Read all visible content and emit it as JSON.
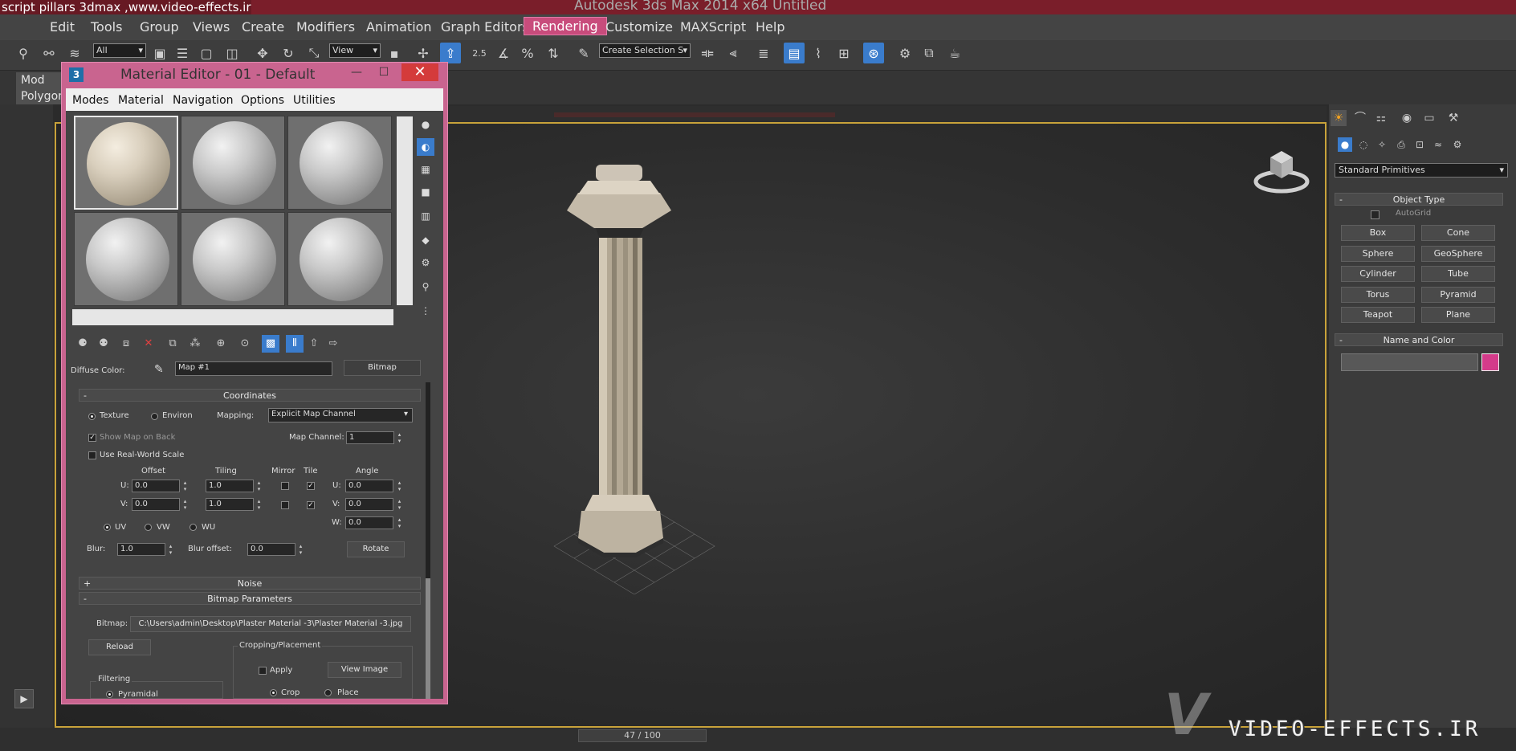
{
  "video_title": "script pillars 3dmax ,www.video-effects.ir",
  "app_title": "Autodesk 3ds Max  2014 x64     Untitled",
  "menu": [
    "Edit",
    "Tools",
    "Group",
    "Views",
    "Create",
    "Modifiers",
    "Animation",
    "Graph Editors",
    "Rendering",
    "Customize",
    "MAXScript",
    "Help"
  ],
  "toolbar": {
    "filter_select": "All",
    "ref_coord_select": "View",
    "named_selection_placeholder": "Create Selection S",
    "percent_snap": "%",
    "angle_snap": "2.5"
  },
  "ribbon": {
    "tab_modeling": "Mod",
    "tab_polygon": "Polygon"
  },
  "material_editor": {
    "title": "Material Editor - 01 - Default",
    "menu": [
      "Modes",
      "Material",
      "Navigation",
      "Options",
      "Utilities"
    ],
    "diffuse_label": "Diffuse Color:",
    "map_name": "Map #1",
    "map_type": "Bitmap",
    "coordinates": {
      "title": "Coordinates",
      "texture_label": "Texture",
      "environ_label": "Environ",
      "mapping_label": "Mapping:",
      "mapping_value": "Explicit Map Channel",
      "show_map_on_back": "Show Map on Back",
      "use_real_world": "Use Real-World Scale",
      "map_channel_label": "Map Channel:",
      "map_channel_value": "1",
      "offset_label": "Offset",
      "tiling_label": "Tiling",
      "mirror_label": "Mirror",
      "tile_label": "Tile",
      "angle_label": "Angle",
      "u_label": "U:",
      "v_label": "V:",
      "w_label": "W:",
      "u_offset": "0.0",
      "v_offset": "0.0",
      "u_tiling": "1.0",
      "v_tiling": "1.0",
      "u_angle": "0.0",
      "v_angle": "0.0",
      "w_angle": "0.0",
      "uv_label": "UV",
      "vw_label": "VW",
      "wu_label": "WU",
      "blur_label": "Blur:",
      "blur_value": "1.0",
      "blur_offset_label": "Blur offset:",
      "blur_offset_value": "0.0",
      "rotate_button": "Rotate"
    },
    "noise": {
      "title": "Noise",
      "toggle": "+"
    },
    "bitmap_params": {
      "title": "Bitmap Parameters",
      "bitmap_label": "Bitmap:",
      "bitmap_path": "C:\\Users\\admin\\Desktop\\Plaster Material -3\\Plaster Material -3.jpg",
      "reload_button": "Reload",
      "cropping_label": "Cropping/Placement",
      "apply_label": "Apply",
      "view_image_button": "View Image",
      "filtering_label": "Filtering",
      "pyramidal_label": "Pyramidal",
      "crop_label": "Crop",
      "place_label": "Place"
    }
  },
  "command_panel": {
    "category": "Standard Primitives",
    "object_type_title": "Object Type",
    "autogrid_label": "AutoGrid",
    "buttons": [
      "Box",
      "Cone",
      "Sphere",
      "GeoSphere",
      "Cylinder",
      "Tube",
      "Torus",
      "Pyramid",
      "Teapot",
      "Plane"
    ],
    "name_color_title": "Name and Color",
    "object_color": "#d43b8a"
  },
  "timeline": {
    "frame": "47 / 100"
  },
  "watermark": "VIDEO-EFFECTS.IR",
  "colors": {
    "active_menu": "#c84c7c",
    "viewport_border": "#c8a23a",
    "editor_frame": "#c9648f",
    "selection_blue": "#3a7ccc"
  }
}
